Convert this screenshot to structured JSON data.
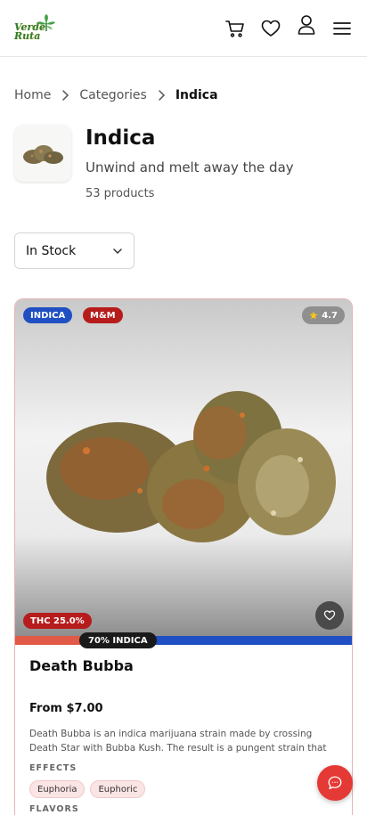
{
  "header": {
    "logo_text": "Verde\nRuta",
    "icons": [
      "cart-icon",
      "heart-icon",
      "user-icon",
      "menu-icon"
    ]
  },
  "breadcrumb": {
    "home": "Home",
    "categories": "Categories",
    "current": "Indica"
  },
  "category": {
    "title": "Indica",
    "subtitle": "Unwind and melt away the day",
    "count": "53 products"
  },
  "filter": {
    "selected": "In Stock"
  },
  "product": {
    "type_badge": "INDICA",
    "brand_badge": "M&M",
    "rating": "4.7",
    "thc": "THC 25.0%",
    "indica_ratio_label": "70% INDICA",
    "indica_ratio": 0.7,
    "name": "Death Bubba",
    "price": "From $7.00",
    "description": "Death Bubba is an indica marijuana strain made by crossing Death Star with Bubba Kush. The result is a pungent strain that produces intense relaxation...",
    "effects_label": "EFFECTS",
    "effects": [
      "Euphoria",
      "Euphoric"
    ],
    "flavors_label": "FLAVORS"
  },
  "colors": {
    "indica_badge": "#1f4fc2",
    "brand_badge": "#b71c1c",
    "accent_red": "#e53935",
    "sativa_bar": "#e05a47"
  }
}
